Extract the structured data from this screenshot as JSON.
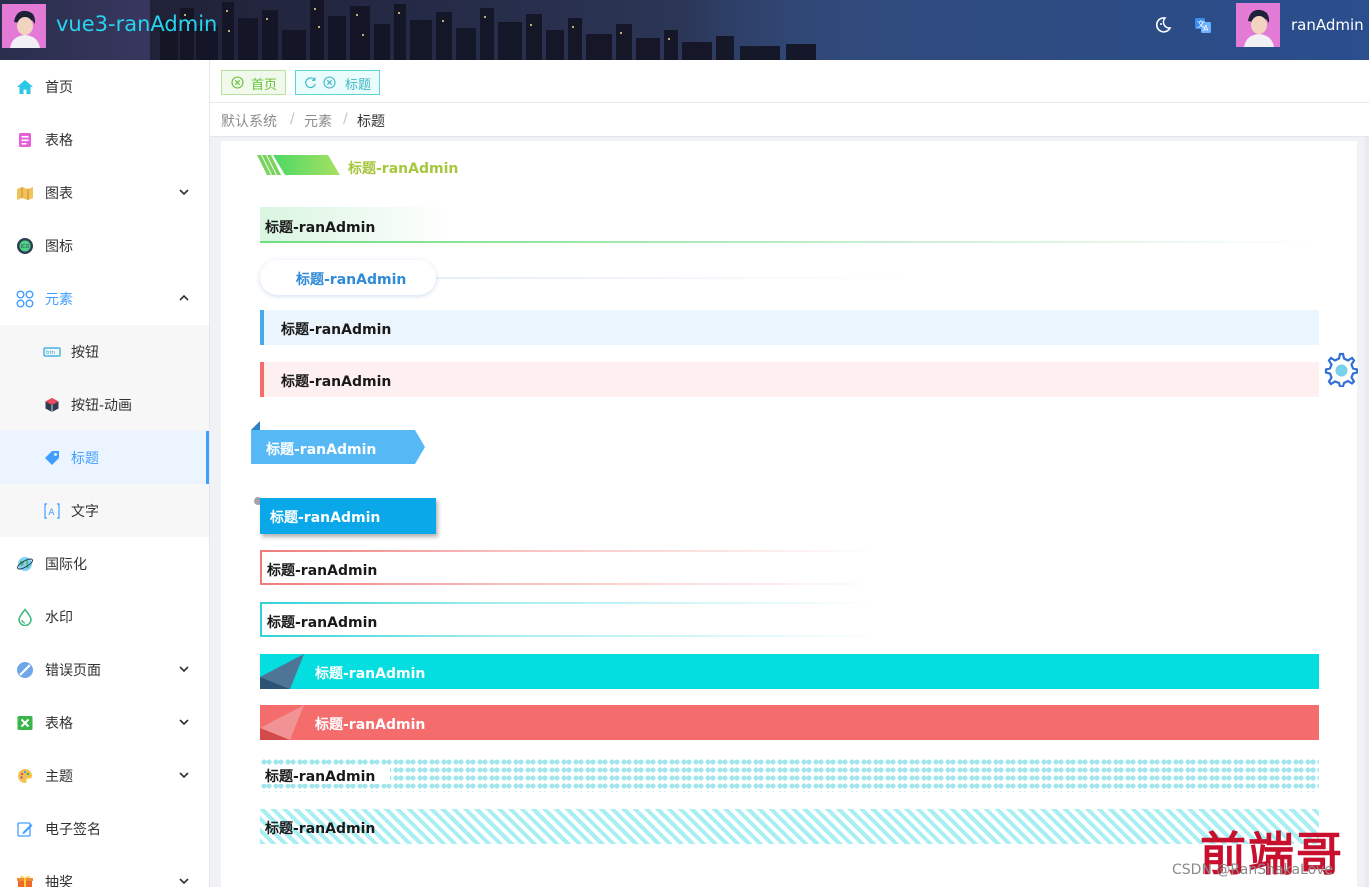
{
  "header": {
    "app_title": "vue3-ranAdmin",
    "user_name": "ranAdmin",
    "theme_icon": "moon-icon",
    "language_icon": "translate-icon"
  },
  "sidebar": {
    "items": [
      {
        "label": "首页",
        "icon": "home-icon"
      },
      {
        "label": "表格",
        "icon": "table-icon"
      },
      {
        "label": "图表",
        "icon": "chart-icon"
      },
      {
        "label": "图标",
        "icon": "icon-gallery-icon"
      },
      {
        "label": "元素",
        "icon": "apps-icon"
      },
      {
        "label": "按钮",
        "icon": "button-icon"
      },
      {
        "label": "按钮-动画",
        "icon": "cube-icon"
      },
      {
        "label": "标题",
        "icon": "tag-icon"
      },
      {
        "label": "文字",
        "icon": "text-icon"
      },
      {
        "label": "国际化",
        "icon": "globe-icon"
      },
      {
        "label": "水印",
        "icon": "drop-icon"
      },
      {
        "label": "错误页面",
        "icon": "slash-icon"
      },
      {
        "label": "表格",
        "icon": "excel-icon"
      },
      {
        "label": "主题",
        "icon": "palette-icon"
      },
      {
        "label": "电子签名",
        "icon": "sign-icon"
      },
      {
        "label": "抽奖",
        "icon": "gift-icon"
      }
    ]
  },
  "tags": {
    "home": "首页",
    "current": "标题"
  },
  "breadcrumb": {
    "items": [
      "默认系统",
      "元素",
      "标题"
    ],
    "separator": "/"
  },
  "titles": {
    "text": "标题-ranAdmin"
  },
  "colors": {
    "accent": "#409eff",
    "cyan": "#05dee0",
    "red": "#f56c6c",
    "green": "#67c23a",
    "header_title": "#27d3f0"
  },
  "watermark": {
    "brand": "前端哥",
    "csdn": "CSDN @RanShakaLove"
  }
}
